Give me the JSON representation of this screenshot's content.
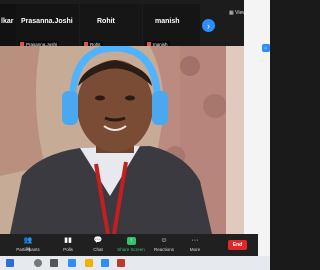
{
  "top_strip": {
    "participants": [
      {
        "name": "lkar",
        "label": ""
      },
      {
        "name": "Prasanna.Joshi",
        "label": "Prasanna.Joshi"
      },
      {
        "name": "Rohit",
        "label": "Rohit"
      },
      {
        "name": "manish",
        "label": "manish"
      }
    ],
    "view_label": "View"
  },
  "toolbar": {
    "participants_label": "Participants",
    "participants_count": "34",
    "polls_label": "Polls",
    "chat_label": "Chat",
    "share_label": "Share Screen",
    "reactions_label": "Reactions",
    "more_label": "More",
    "end_label": "End"
  },
  "colors": {
    "share_green": "#31c46c",
    "end_red": "#e02828",
    "headphone_blue": "#4fb3ff"
  }
}
